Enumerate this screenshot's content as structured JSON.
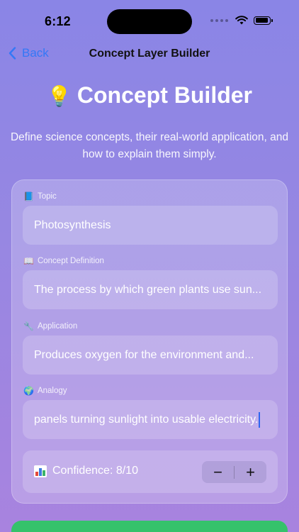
{
  "status": {
    "time": "6:12"
  },
  "nav": {
    "back_label": "Back",
    "title": "Concept Layer Builder"
  },
  "hero": {
    "icon": "💡",
    "title": "Concept Builder",
    "subtitle": "Define science concepts, their real-world application, and how to explain them simply."
  },
  "form": {
    "topic": {
      "icon": "📘",
      "label": "Topic",
      "value": "Photosynthesis"
    },
    "definition": {
      "icon": "📖",
      "label": "Concept Definition",
      "value": "The process by which green plants use sun..."
    },
    "application": {
      "icon": "🔧",
      "label": "Application",
      "value": "Produces oxygen for the environment and..."
    },
    "analogy": {
      "icon": "🌍",
      "label": "Analogy",
      "value": "panels turning sunlight into usable electricity."
    },
    "confidence": {
      "label": "Confidence: 8/10",
      "minus": "−",
      "plus": "+",
      "value": 8,
      "max": 10
    }
  },
  "colors": {
    "accent": "#3478f6",
    "primary_button": "#35c26b",
    "caret": "#2f66f0"
  }
}
